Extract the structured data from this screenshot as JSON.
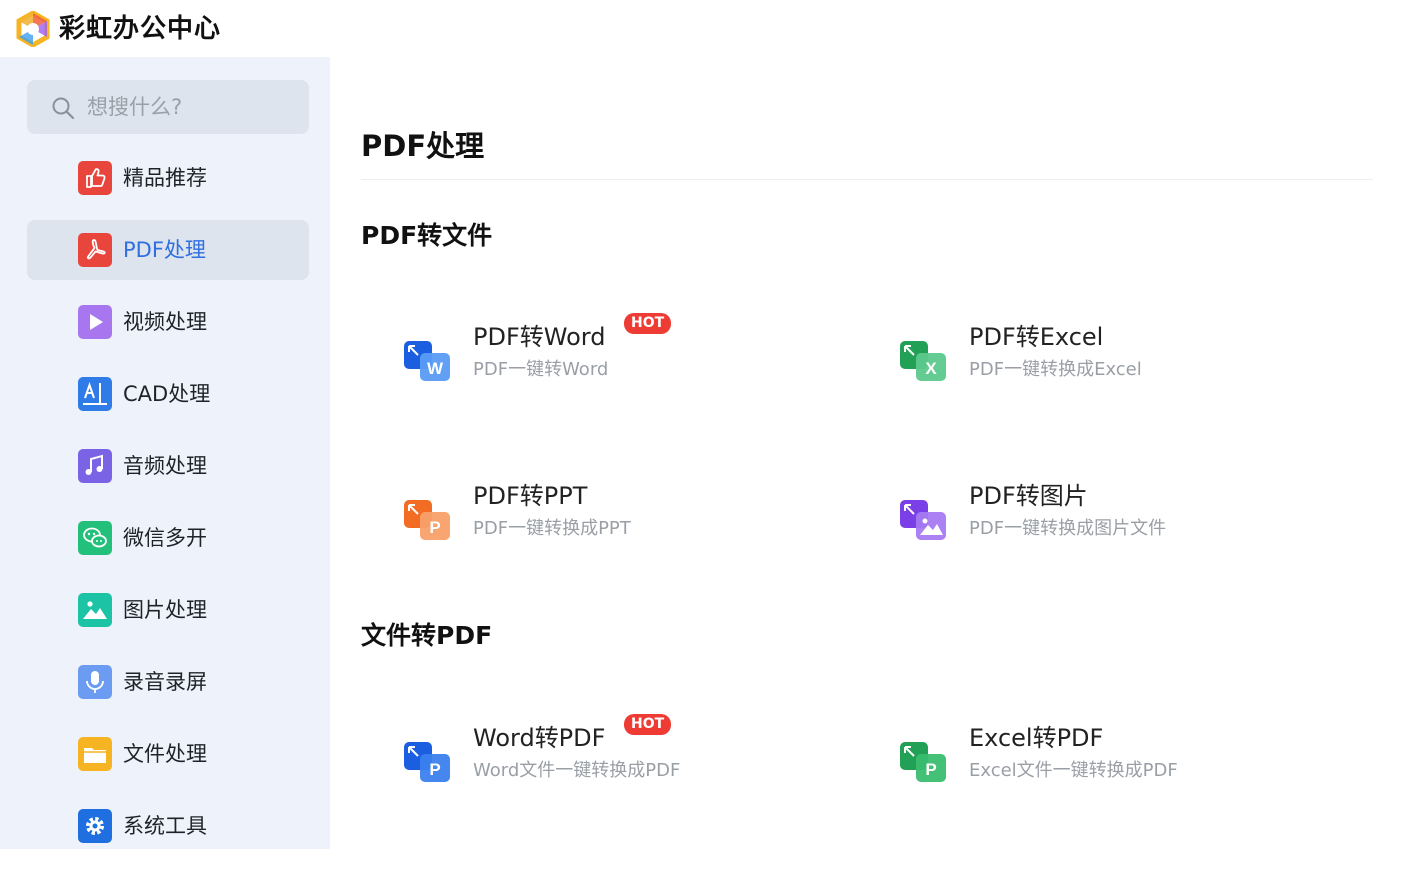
{
  "app": {
    "title": "彩虹办公中心"
  },
  "sidebar": {
    "search_placeholder": "想搜什么?",
    "items": [
      {
        "label": "精品推荐",
        "icon": "thumbs-up-icon",
        "color": "#e8453c",
        "active": false
      },
      {
        "label": "PDF处理",
        "icon": "pdf-icon",
        "color": "#e8453c",
        "active": true
      },
      {
        "label": "视频处理",
        "icon": "play-icon",
        "color": "#a877f0",
        "active": false
      },
      {
        "label": "CAD处理",
        "icon": "cad-icon",
        "color": "#2f7be8",
        "active": false
      },
      {
        "label": "音频处理",
        "icon": "music-icon",
        "color": "#7b63e6",
        "active": false
      },
      {
        "label": "微信多开",
        "icon": "wechat-icon",
        "color": "#22c07a",
        "active": false
      },
      {
        "label": "图片处理",
        "icon": "image-icon",
        "color": "#1dc3a5",
        "active": false
      },
      {
        "label": "录音录屏",
        "icon": "microphone-icon",
        "color": "#6b9cf2",
        "active": false
      },
      {
        "label": "文件处理",
        "icon": "folder-icon",
        "color": "#f7b422",
        "active": false
      },
      {
        "label": "系统工具",
        "icon": "gear-icon",
        "color": "#1f6fe0",
        "active": false
      }
    ]
  },
  "main": {
    "title": "PDF处理",
    "sections": [
      {
        "title": "PDF转文件",
        "tools": [
          {
            "title": "PDF转Word",
            "subtitle": "PDF一键转Word",
            "hot": "HOT",
            "icon": "pdf-to-word-icon",
            "color": "#2f6fe8"
          },
          {
            "title": "PDF转Excel",
            "subtitle": "PDF一键转换成Excel",
            "hot": "",
            "icon": "pdf-to-excel-icon",
            "color": "#2eb062"
          },
          {
            "title": "PDF转PPT",
            "subtitle": "PDF一键转换成PPT",
            "hot": "",
            "icon": "pdf-to-ppt-icon",
            "color": "#f57a32"
          },
          {
            "title": "PDF转图片",
            "subtitle": "PDF一键转换成图片文件",
            "hot": "",
            "icon": "pdf-to-image-icon",
            "color": "#8a4ff0"
          }
        ]
      },
      {
        "title": "文件转PDF",
        "tools": [
          {
            "title": "Word转PDF",
            "subtitle": "Word文件一键转换成PDF",
            "hot": "HOT",
            "icon": "word-to-pdf-icon",
            "color": "#2f6fe8"
          },
          {
            "title": "Excel转PDF",
            "subtitle": "Excel文件一键转换成PDF",
            "hot": "",
            "icon": "excel-to-pdf-icon",
            "color": "#2eb062"
          }
        ]
      }
    ]
  }
}
